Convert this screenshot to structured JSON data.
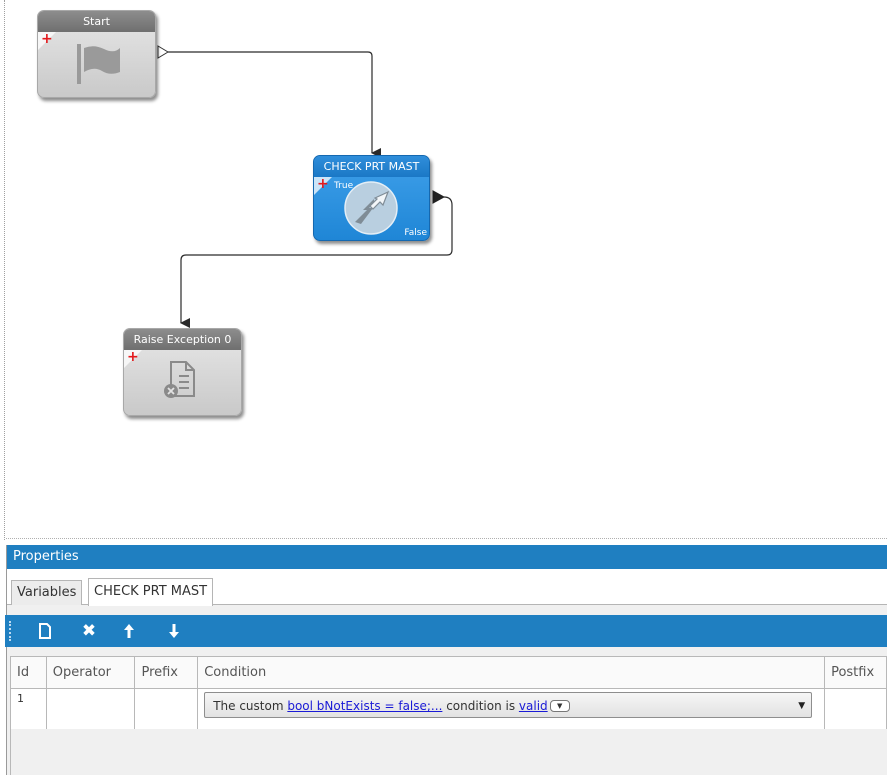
{
  "nodes": {
    "start": {
      "title": "Start",
      "icon": "flag-icon"
    },
    "check": {
      "title": "CHECK PRT MAST",
      "true_label": "True",
      "false_label": "False",
      "icon": "decision-arrows-icon"
    },
    "raise": {
      "title": "Raise Exception 0",
      "icon": "document-error-icon"
    }
  },
  "colors": {
    "node_blue": "#1f86d6",
    "node_gray": "#c9c9c9",
    "panel_accent": "#1f7fc1",
    "add_marker": "#e3191c"
  },
  "panel": {
    "title": "Properties",
    "tabs": [
      "Variables",
      "CHECK PRT MAST"
    ],
    "active_tab": 1,
    "toolbar": {
      "new": "🗋",
      "delete": "✖",
      "up": "🠕",
      "down": "🠗"
    },
    "grid": {
      "columns": [
        "Id",
        "Operator",
        "Prefix",
        "Condition",
        "Postfix"
      ],
      "rows": [
        {
          "id": "1",
          "operator": "",
          "prefix": "",
          "condition": {
            "prefix_text": "The custom ",
            "link_text": "bool bNotExists = false;...",
            "middle_text": " condition is ",
            "state_link": "valid"
          },
          "postfix": ""
        }
      ]
    }
  }
}
